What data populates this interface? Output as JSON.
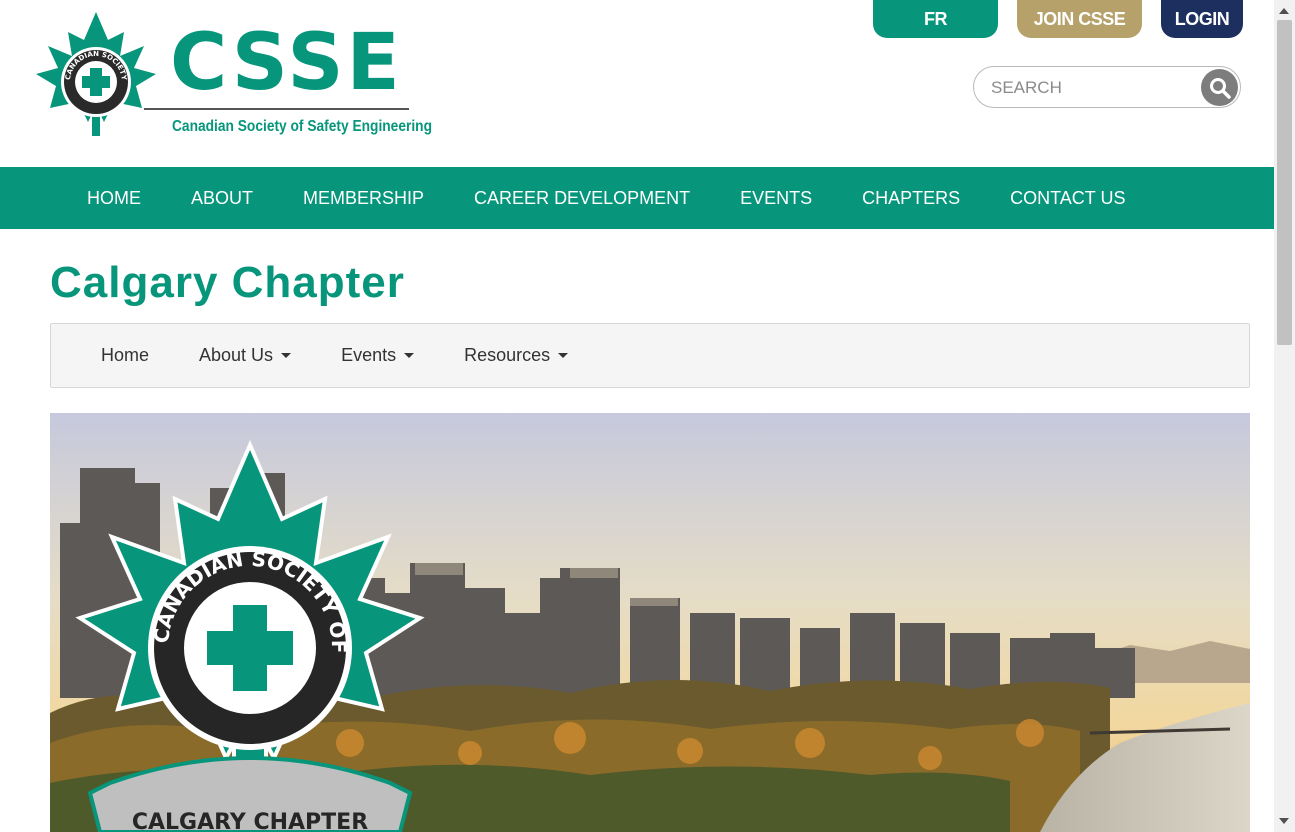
{
  "header": {
    "logo_text": "CSSE",
    "logo_subtitle": "Canadian Society of Safety Engineering",
    "badge_ring_text": "CANADIAN SOCIETY OF SAFETY ENGINEERING",
    "top_buttons": {
      "fr": "FR",
      "join": "JOIN CSSE",
      "login": "LOGIN"
    },
    "search": {
      "placeholder": "SEARCH",
      "icon": "search-icon"
    }
  },
  "main_nav": {
    "items": [
      "HOME",
      "ABOUT",
      "MEMBERSHIP",
      "CAREER DEVELOPMENT",
      "EVENTS",
      "CHAPTERS",
      "CONTACT US"
    ]
  },
  "page": {
    "title": "Calgary Chapter"
  },
  "sub_nav": {
    "items": [
      {
        "label": "Home",
        "dropdown": false
      },
      {
        "label": "About Us",
        "dropdown": true
      },
      {
        "label": "Events",
        "dropdown": true
      },
      {
        "label": "Resources",
        "dropdown": true
      }
    ]
  },
  "hero": {
    "image": "calgary-skyline-photo",
    "badge_ring_text": "CANADIAN SOCIETY OF SAFETY ENGINEERING",
    "banner_text": "CALGARY CHAPTER"
  },
  "colors": {
    "brand_green": "#07967b",
    "join_gold": "#b6a16a",
    "login_navy": "#1c2f5e",
    "subnav_bg": "#f5f5f5"
  }
}
